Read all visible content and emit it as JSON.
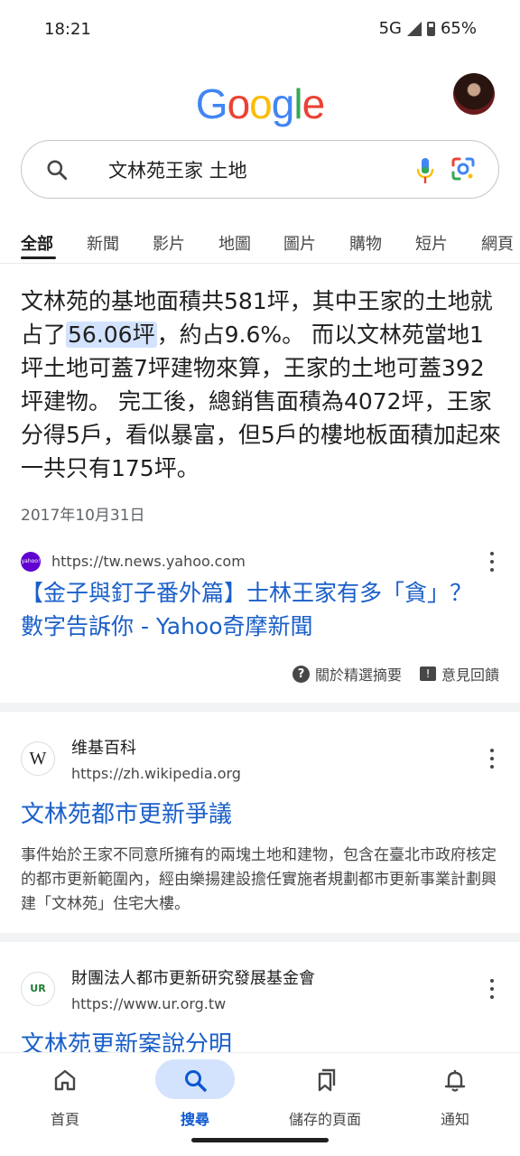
{
  "status": {
    "time": "18:21",
    "network": "5G",
    "battery": "65%"
  },
  "logo": {
    "letters": [
      "G",
      "o",
      "o",
      "g",
      "l",
      "e"
    ],
    "colors": [
      "#4285f4",
      "#ea4335",
      "#fbbc05",
      "#4285f4",
      "#34a853",
      "#ea4335"
    ]
  },
  "search": {
    "query": "文林苑王家 土地"
  },
  "tabs": [
    {
      "label": "全部",
      "active": true
    },
    {
      "label": "新聞"
    },
    {
      "label": "影片"
    },
    {
      "label": "地圖"
    },
    {
      "label": "圖片"
    },
    {
      "label": "購物"
    },
    {
      "label": "短片"
    },
    {
      "label": "網頁"
    }
  ],
  "featured": {
    "text_before": "文林苑的基地面積共581坪，其中王家的土地就占了",
    "highlight": "56.06坪",
    "text_after": "，約占9.6%。 而以文林苑當地1坪土地可蓋7坪建物來算，王家的土地可蓋392坪建物。 完工後，總銷售面積為4072坪，王家分得5戶，看似暴富，但5戶的樓地板面積加起來一共只有175坪。",
    "date": "2017年10月31日",
    "favicon_text": "yahoo!",
    "source_url": "https://tw.news.yahoo.com",
    "title": "【金子與釘子番外篇】士林王家有多「貪」？數字告訴你 - Yahoo奇摩新聞",
    "about_label": "關於精選摘要",
    "feedback_label": "意見回饋"
  },
  "results": [
    {
      "site_name": "维基百科",
      "icon_text": "W",
      "url": "https://zh.wikipedia.org",
      "title": "文林苑都市更新爭議",
      "description": "事件始於王家不同意所擁有的兩塊土地和建物，包含在臺北市政府核定的都市更新範圍內，經由樂揚建設擔任實施者規劃都市更新事業計劃興建「文林苑」住宅大樓。"
    },
    {
      "site_name": "財團法人都市更新研究發展基金會",
      "icon_text": "UR",
      "url": "https://www.ur.org.tw",
      "title": "文林苑更新案說分明"
    }
  ],
  "bottom_nav": [
    {
      "label": "首頁",
      "icon": "home-icon"
    },
    {
      "label": "搜尋",
      "icon": "search-icon",
      "active": true
    },
    {
      "label": "儲存的頁面",
      "icon": "bookmarks-icon"
    },
    {
      "label": "通知",
      "icon": "bell-icon"
    }
  ],
  "colors": {
    "link": "#1a0dab",
    "accent": "#0b57d0",
    "highlight": "#d3e3fd"
  }
}
